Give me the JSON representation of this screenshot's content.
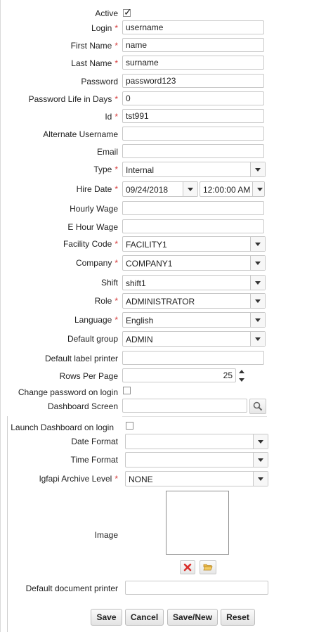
{
  "form": {
    "active": {
      "label": "Active",
      "check": "✓"
    },
    "login": {
      "label": "Login",
      "value": "username"
    },
    "first_name": {
      "label": "First Name",
      "value": "name"
    },
    "last_name": {
      "label": "Last Name",
      "value": "surname"
    },
    "password": {
      "label": "Password",
      "value": "password123"
    },
    "password_life": {
      "label": "Password Life in Days",
      "value": "0"
    },
    "id": {
      "label": "Id",
      "value": "tst991"
    },
    "alternate_username": {
      "label": "Alternate Username",
      "value": ""
    },
    "email": {
      "label": "Email",
      "value": ""
    },
    "type": {
      "label": "Type",
      "value": "Internal"
    },
    "hire_date": {
      "label": "Hire Date",
      "date": "09/24/2018",
      "time": "12:00:00 AM"
    },
    "hourly_wage": {
      "label": "Hourly Wage",
      "value": ""
    },
    "e_hour_wage": {
      "label": "E Hour Wage",
      "value": ""
    },
    "facility_code": {
      "label": "Facility Code",
      "value": "FACILITY1"
    },
    "company": {
      "label": "Company",
      "value": "COMPANY1"
    },
    "shift": {
      "label": "Shift",
      "value": "shift1"
    },
    "role": {
      "label": "Role",
      "value": "ADMINISTRATOR"
    },
    "language": {
      "label": "Language",
      "value": "English"
    },
    "default_group": {
      "label": "Default group",
      "value": "ADMIN"
    },
    "default_label_printer": {
      "label": "Default label printer",
      "value": ""
    },
    "rows_per_page": {
      "label": "Rows Per Page",
      "value": "25"
    },
    "change_password": {
      "label": "Change password on login"
    },
    "dashboard_screen": {
      "label": "Dashboard Screen",
      "value": ""
    },
    "launch_dashboard": {
      "label": "Launch Dashboard on login"
    },
    "date_format": {
      "label": "Date Format",
      "value": ""
    },
    "time_format": {
      "label": "Time Format",
      "value": ""
    },
    "archive_level": {
      "label": "lgfapi Archive Level",
      "value": "NONE"
    },
    "image": {
      "label": "Image"
    },
    "default_document_printer": {
      "label": "Default document printer",
      "value": ""
    },
    "required_marker": "*"
  },
  "buttons": {
    "save": "Save",
    "cancel": "Cancel",
    "save_new": "Save/New",
    "reset": "Reset"
  },
  "icons": {
    "delete": "delete-icon",
    "browse": "folder-open-icon",
    "search": "search-icon"
  },
  "colors": {
    "required": "#d43a3a",
    "delete": "#d9302c",
    "folder": "#e0a623"
  }
}
